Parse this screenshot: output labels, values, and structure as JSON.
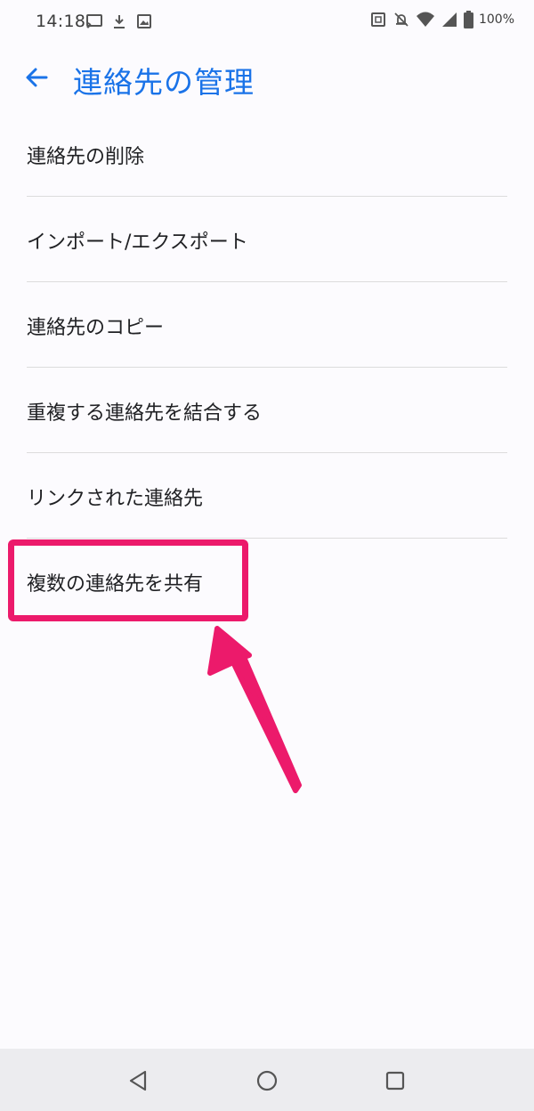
{
  "status_bar": {
    "time": "14:18",
    "battery_percent": "100%",
    "left_icons": [
      "cast-icon",
      "download-icon",
      "image-icon"
    ],
    "right_icons": [
      "nfc-icon",
      "notifications-off-icon",
      "wifi-icon",
      "signal-icon",
      "battery-icon"
    ]
  },
  "app_bar": {
    "title": "連絡先の管理",
    "back_icon": "arrow-back-icon"
  },
  "menu": {
    "items": [
      {
        "label": "連絡先の削除"
      },
      {
        "label": "インポート/エクスポート"
      },
      {
        "label": "連絡先のコピー"
      },
      {
        "label": "重複する連絡先を結合する"
      },
      {
        "label": "リンクされた連絡先"
      },
      {
        "label": "複数の連絡先を共有"
      }
    ]
  },
  "annotation": {
    "highlight_color": "#ec1a6b",
    "highlighted_item": "複数の連絡先を共有"
  },
  "nav_bar": {
    "buttons": [
      "back-triangle-icon",
      "home-circle-icon",
      "recents-square-icon"
    ]
  },
  "colors": {
    "accent": "#1a73e8",
    "background": "#fcfbfe",
    "nav_background": "#ececef"
  }
}
